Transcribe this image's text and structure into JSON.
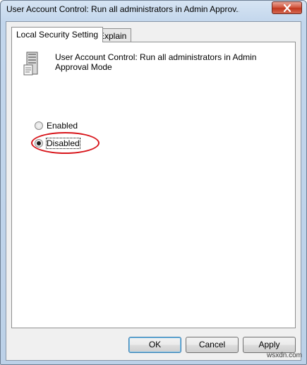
{
  "window": {
    "title": "User Account Control: Run all administrators in Admin Approv..."
  },
  "tabs": [
    {
      "label": "Local Security Setting",
      "selected": true
    },
    {
      "label": "Explain",
      "selected": false
    }
  ],
  "policy": {
    "name": "User Account Control: Run all administrators in Admin Approval Mode",
    "icon": "server-policy-icon"
  },
  "options": [
    {
      "label": "Enabled",
      "checked": false
    },
    {
      "label": "Disabled",
      "checked": true
    }
  ],
  "buttons": {
    "ok": "OK",
    "cancel": "Cancel",
    "apply": "Apply"
  },
  "annotation_color": "#d8151b",
  "watermark": "wsxdn.com"
}
